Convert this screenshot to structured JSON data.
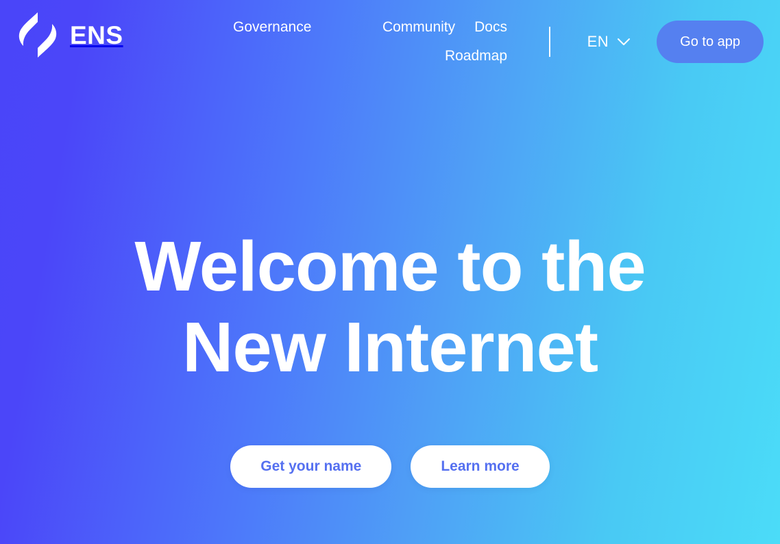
{
  "site": {
    "brand_name": "ENS",
    "logo_icon": "ens-logo-icon"
  },
  "header": {
    "nav_links": [
      {
        "label": "Governance"
      },
      {
        "label": "Community"
      },
      {
        "label": "Docs"
      },
      {
        "label": "Roadmap"
      }
    ],
    "language": {
      "selected": "EN",
      "chevron_icon": "chevron-down-icon"
    },
    "app_button_label": "Go to app"
  },
  "hero": {
    "title_line_1": "Welcome to the",
    "title_line_2": "New Internet",
    "primary_button_label": "Get your name",
    "secondary_button_label": "Learn more"
  },
  "colors": {
    "gradient_start": "#4A45F9",
    "gradient_end": "#4BDCF8",
    "accent_button": "#5580F0",
    "pill_text": "#5570F0",
    "text_on_gradient": "#FFFFFF"
  }
}
